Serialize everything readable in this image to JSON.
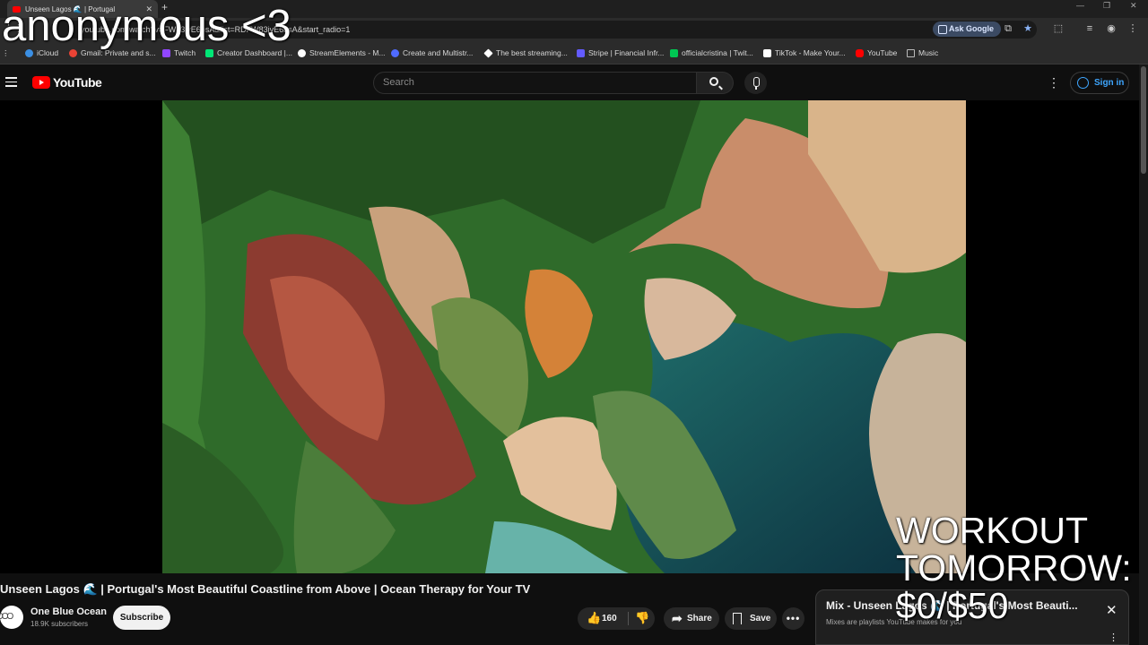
{
  "browser": {
    "tab_title": "Unseen Lagos 🌊 | Portugal",
    "url": "youtube.com/watch?v=FW83ivE6bsA&list=RDFW83ivE6bsA&start_radio=1",
    "ask_google": "Ask Google"
  },
  "bookmarks": [
    {
      "label": "iCloud",
      "color": "#3b8fe3"
    },
    {
      "label": "Gmail: Private and s...",
      "color": "#ea4335"
    },
    {
      "label": "Twitch",
      "color": "#9146ff"
    },
    {
      "label": "Creator Dashboard |...",
      "color": "#00e676"
    },
    {
      "label": "StreamElements - M...",
      "color": "#ffffff"
    },
    {
      "label": "Create and Multistr...",
      "color": "#4f6bff"
    },
    {
      "label": "The best streaming...",
      "color": "#ffffff"
    },
    {
      "label": "Stripe | Financial Infr...",
      "color": "#635bff"
    },
    {
      "label": "officialcristina | Twit...",
      "color": "#00c853"
    },
    {
      "label": "TikTok - Make Your...",
      "color": "#ffffff"
    },
    {
      "label": "YouTube",
      "color": "#ff0000"
    },
    {
      "label": "Music",
      "color": "#bbbbbb"
    }
  ],
  "youtube": {
    "logo_text": "YouTube",
    "search_placeholder": "Search",
    "sign_in": "Sign in"
  },
  "video": {
    "title": "Unseen Lagos 🌊 | Portugal's Most Beautiful Coastline from Above | Ocean Therapy for Your TV",
    "channel": "One Blue Ocean",
    "subscribers": "18.9K subscribers",
    "subscribe_label": "Subscribe",
    "likes": "160",
    "share_label": "Share",
    "save_label": "Save"
  },
  "mix": {
    "title": "Mix - Unseen Lagos 🌊 | Portugal's Most Beauti...",
    "subtitle": "Mixes are playlists YouTube makes for you"
  },
  "overlays": {
    "name": "anonymous <3",
    "goal_line1": "WORKOUT",
    "goal_line2": "TOMORROW:",
    "goal_line3": "$0/$50"
  }
}
